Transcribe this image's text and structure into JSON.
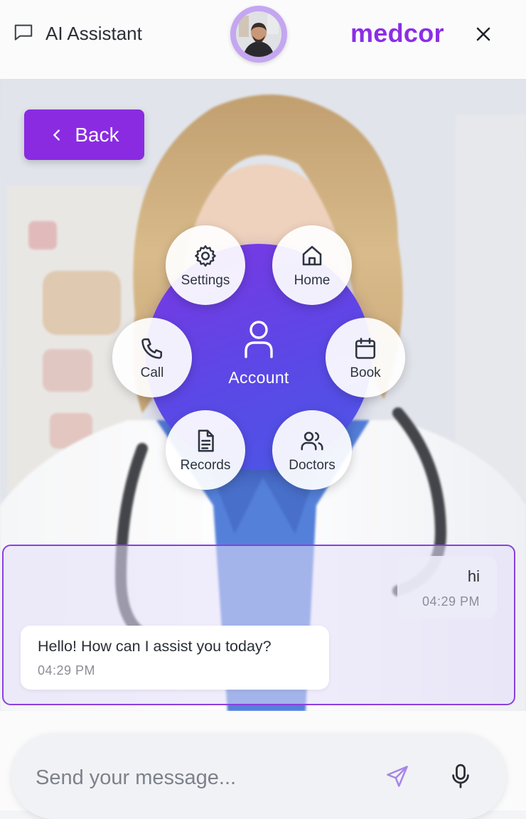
{
  "header": {
    "title": "AI Assistant",
    "brand": "medcor",
    "chat_icon": "chat-bubble-icon",
    "close_icon": "close-icon"
  },
  "back_button": {
    "label": "Back",
    "icon": "chevron-left-icon"
  },
  "radial_menu": {
    "center": {
      "label": "Account",
      "icon": "user-icon"
    },
    "items": [
      {
        "label": "Settings",
        "icon": "gear-icon"
      },
      {
        "label": "Home",
        "icon": "home-icon"
      },
      {
        "label": "Call",
        "icon": "phone-icon"
      },
      {
        "label": "Book",
        "icon": "calendar-icon"
      },
      {
        "label": "Records",
        "icon": "document-icon"
      },
      {
        "label": "Doctors",
        "icon": "users-icon"
      }
    ]
  },
  "chat": {
    "messages": [
      {
        "sender": "user",
        "text": "hi",
        "time": "04:29 PM"
      },
      {
        "sender": "assistant",
        "text": "Hello! How can I assist you today?",
        "time": "04:29 PM"
      }
    ]
  },
  "composer": {
    "placeholder": "Send your message...",
    "value": "",
    "send_icon": "send-icon",
    "mic_icon": "microphone-icon"
  },
  "colors": {
    "accent": "#8a2be2",
    "brand": "#8b2ee6",
    "hub_gradient_start": "#7b37e3",
    "hub_gradient_end": "#4a57e6",
    "chat_border": "#8b3fe0"
  }
}
